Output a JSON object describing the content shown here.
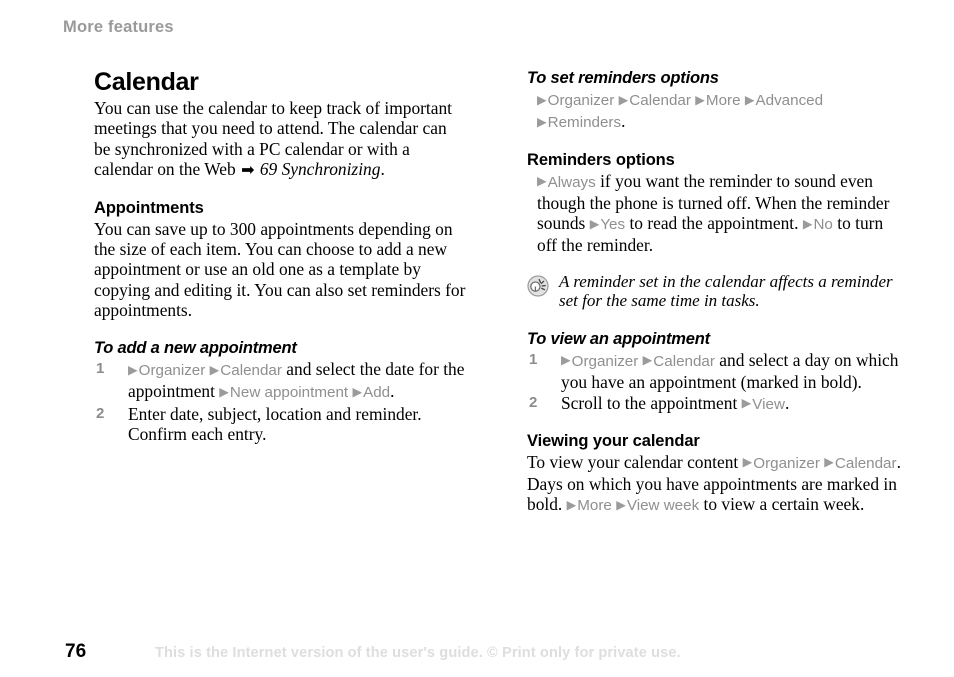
{
  "page": {
    "running_head": "More features",
    "page_number": "76",
    "footer_note": "This is the Internet version of the user's guide. © Print only for private use.",
    "colors": {
      "menu_gray": "#8f8f8f",
      "running_head_gray": "#9a9a9a",
      "footer_gray": "#dedede",
      "step_number_gray": "#8c8c8c",
      "text_black": "#000000"
    }
  },
  "left_column": {
    "chapter_title": "Calendar",
    "intro": {
      "part1": "You can use the calendar to keep track of important meetings that you need to attend. The calendar can be synchronized with a PC calendar or with a calendar on the Web",
      "ref_arrow": "➡",
      "ref_text": "69 Synchronizing",
      "period": "."
    },
    "appointments": {
      "heading": "Appointments",
      "body": "You can save up to 300 appointments depending on the size of each item. You can choose to add a new appointment or use an old one as a template by copying and editing it. You can also set reminders for appointments."
    },
    "add_appointment": {
      "heading": "To add a new appointment",
      "step1": {
        "num": "1",
        "arrow1": "▶",
        "menu1": "Organizer",
        "arrow2": "▶",
        "menu2": "Calendar",
        "text1": "and select the date for the appointment",
        "arrow3": "▶",
        "menu3": "New appointment",
        "arrow4": "▶",
        "menu4": "Add",
        "text2": "."
      },
      "step2": {
        "num": "2",
        "text": "Enter date, subject, location and reminder. Confirm each entry."
      }
    }
  },
  "right_column": {
    "set_reminders": {
      "heading": "To set reminders options",
      "arrow1": "▶",
      "menu1": "Organizer",
      "arrow2": "▶",
      "menu2": "Calendar",
      "arrow3": "▶",
      "menu3": "More",
      "arrow4": "▶",
      "menu4": "Advanced",
      "arrow5": "▶",
      "menu5": "Reminders",
      "period": "."
    },
    "reminders_options": {
      "heading": "Reminders options",
      "arrow1": "▶",
      "menu1": "Always",
      "text1": "if you want the reminder to sound even though the phone is turned off. When the reminder sounds",
      "arrow2": "▶",
      "menu2": "Yes",
      "text2": "to read the appointment.",
      "arrow3": "▶",
      "menu3": "No",
      "text3": "to turn off the reminder."
    },
    "tip": {
      "icon": "tip-bulb-icon",
      "text": "A reminder set in the calendar affects a reminder set for the same time in tasks."
    },
    "view_appointment": {
      "heading": "To view an appointment",
      "step1": {
        "num": "1",
        "arrow1": "▶",
        "menu1": "Organizer",
        "arrow2": "▶",
        "menu2": "Calendar",
        "text1": "and select a day on which you have an appointment (marked in bold)."
      },
      "step2": {
        "num": "2",
        "text1": "Scroll to the appointment",
        "arrow1": "▶",
        "menu1": "View",
        "text2": "."
      }
    },
    "viewing_calendar": {
      "heading": "Viewing your calendar",
      "text1": "To view your calendar content",
      "arrow1": "▶",
      "menu1": "Organizer",
      "arrow2": "▶",
      "menu2": "Calendar",
      "text2": ". Days on which you have appointments are marked in bold.",
      "arrow3": "▶",
      "menu3": "More",
      "arrow4": "▶",
      "menu4": "View week",
      "text3": "to view a certain week."
    }
  }
}
